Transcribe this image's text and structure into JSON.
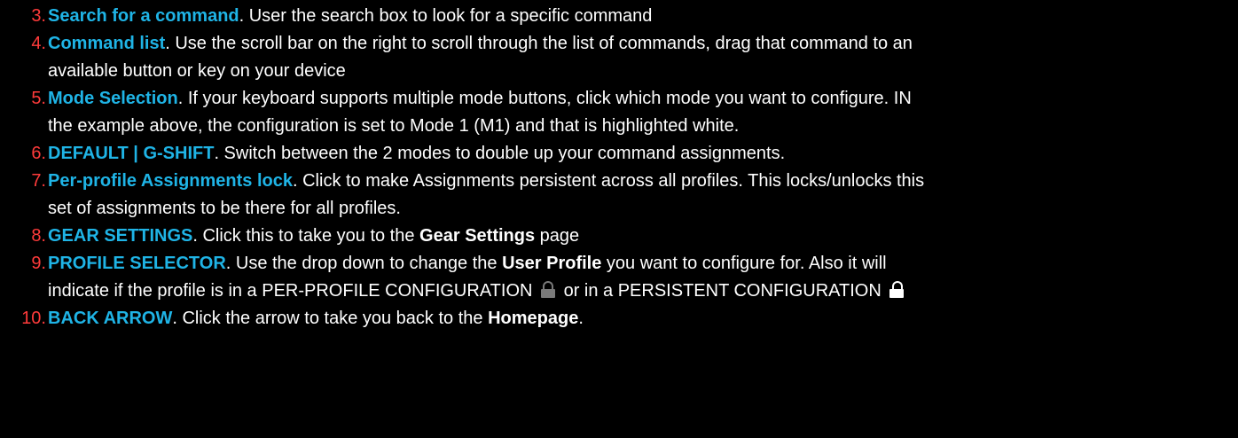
{
  "colors": {
    "number": "#ff3b3b",
    "title": "#1fb4e6",
    "text": "#ffffff",
    "background": "#000000"
  },
  "items": [
    {
      "number": "3.",
      "title": "Search for a command",
      "text": ".  User the search box to look for a specific command"
    },
    {
      "number": "4.",
      "title": "Command list",
      "text": ".  Use the scroll bar on the right to scroll through the list of commands, drag that command to an",
      "text2": "available button or key on your device"
    },
    {
      "number": "5.",
      "title": "Mode Selection",
      "text": ".  If your keyboard supports multiple mode buttons, click which mode you want to configure. IN",
      "text2": "the example above, the configuration is set to Mode 1 (M1) and that is highlighted white."
    },
    {
      "number": "6.",
      "title": "DEFAULT | G-SHIFT",
      "text": ".  Switch between the 2 modes to double up your command assignments."
    },
    {
      "number": "7.",
      "title": "Per-profile Assignments lock",
      "text": ".  Click to make Assignments persistent across all profiles.  This locks/unlocks this",
      "text2": "set of assignments to be there for all profiles."
    },
    {
      "number": "8.",
      "title": "GEAR SETTINGS",
      "text": ".  Click this to take you to the ",
      "bold": "Gear Settings",
      "text_after": " page"
    },
    {
      "number": "9.",
      "title": "PROFILE SELECTOR",
      "text": ".  Use the drop down to change the ",
      "bold": "User Profile",
      "text_after": " you want to configure for. Also it will",
      "text2": "indicate if the profile is in a PER-PROFILE CONFIGURATION ",
      "text2_mid": " or in a PERSISTENT CONFIGURATION ",
      "icon_unlocked": "unlocked-padlock-icon",
      "icon_locked": "locked-padlock-icon"
    },
    {
      "number": "10.",
      "title": "BACK ARROW",
      "text": ".  Click the arrow to take you back to the ",
      "bold": "Homepage",
      "text_after": "."
    }
  ]
}
